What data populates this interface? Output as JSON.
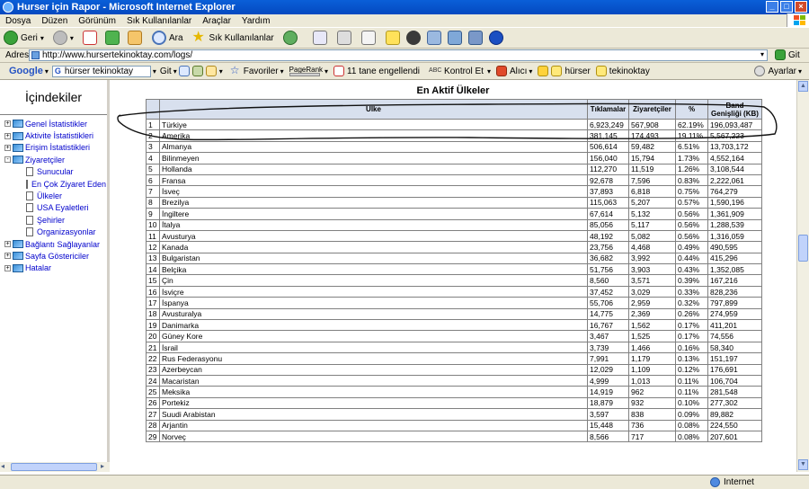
{
  "window": {
    "title": "Hurser için Rapor - Microsoft Internet Explorer"
  },
  "menu": [
    "Dosya",
    "Düzen",
    "Görünüm",
    "Sık Kullanılanlar",
    "Araçlar",
    "Yardım"
  ],
  "toolbar": {
    "back": "Geri",
    "search": "Ara",
    "favorites": "Sık Kullanılanlar"
  },
  "address": {
    "label": "Adres",
    "url": "http://www.hursertekinoktay.com/logs/",
    "go": "Git"
  },
  "google": {
    "logo": "Google",
    "query": "hürser tekinoktay",
    "go": "Git",
    "favorites": "Favoriler",
    "pagerank": "PageRank",
    "blocked": "11 tane engellendi",
    "spell": "Kontrol Et",
    "send": "Alıcı",
    "hl1": "hürser",
    "hl2": "tekinoktay",
    "settings": "Ayarlar"
  },
  "sidebar": {
    "title": "İçindekiler",
    "items": [
      {
        "label": "Genel İstatistikler",
        "level": 0,
        "type": "book",
        "exp": "+"
      },
      {
        "label": "Aktivite İstatistikleri",
        "level": 0,
        "type": "book",
        "exp": "+"
      },
      {
        "label": "Erişim İstatistikleri",
        "level": 0,
        "type": "book",
        "exp": "+"
      },
      {
        "label": "Ziyaretçiler",
        "level": 0,
        "type": "book",
        "exp": "-"
      },
      {
        "label": "Sunucular",
        "level": 1,
        "type": "doc"
      },
      {
        "label": "En Çok Ziyaret Eden Üs",
        "level": 1,
        "type": "doc"
      },
      {
        "label": "Ülkeler",
        "level": 1,
        "type": "doc"
      },
      {
        "label": "USA Eyaletleri",
        "level": 1,
        "type": "doc"
      },
      {
        "label": "Şehirler",
        "level": 1,
        "type": "doc"
      },
      {
        "label": "Organizasyonlar",
        "level": 1,
        "type": "doc"
      },
      {
        "label": "Bağlantı Sağlayanlar",
        "level": 0,
        "type": "book",
        "exp": "+"
      },
      {
        "label": "Sayfa Göstericiler",
        "level": 0,
        "type": "book",
        "exp": "+"
      },
      {
        "label": "Hatalar",
        "level": 0,
        "type": "book",
        "exp": "+"
      }
    ]
  },
  "report": {
    "title": "En Aktif Ülkeler",
    "columns": [
      "",
      "Ülke",
      "Tıklamalar",
      "Ziyaretçiler",
      "%",
      "Band Genişliği (KB)"
    ],
    "rows": [
      [
        "1",
        "Türkiye",
        "6,923,249",
        "567,908",
        "62.19%",
        "196,093,487"
      ],
      [
        "2",
        "Amerika",
        "381,145",
        "174,493",
        "19.11%",
        "5,567,223"
      ],
      [
        "3",
        "Almanya",
        "506,614",
        "59,482",
        "6.51%",
        "13,703,172"
      ],
      [
        "4",
        "Bilinmeyen",
        "156,040",
        "15,794",
        "1.73%",
        "4,552,164"
      ],
      [
        "5",
        "Hollanda",
        "112,270",
        "11,519",
        "1.26%",
        "3,108,544"
      ],
      [
        "6",
        "Fransa",
        "92,678",
        "7,596",
        "0.83%",
        "2,222,061"
      ],
      [
        "7",
        "İsveç",
        "37,893",
        "6,818",
        "0.75%",
        "764,279"
      ],
      [
        "8",
        "Brezilya",
        "115,063",
        "5,207",
        "0.57%",
        "1,590,196"
      ],
      [
        "9",
        "İngiltere",
        "67,614",
        "5,132",
        "0.56%",
        "1,361,909"
      ],
      [
        "10",
        "İtalya",
        "85,056",
        "5,117",
        "0.56%",
        "1,288,539"
      ],
      [
        "11",
        "Avusturya",
        "48,192",
        "5,082",
        "0.56%",
        "1,316,059"
      ],
      [
        "12",
        "Kanada",
        "23,756",
        "4,468",
        "0.49%",
        "490,595"
      ],
      [
        "13",
        "Bulgaristan",
        "36,682",
        "3,992",
        "0.44%",
        "415,296"
      ],
      [
        "14",
        "Belçika",
        "51,756",
        "3,903",
        "0.43%",
        "1,352,085"
      ],
      [
        "15",
        "Çin",
        "8,560",
        "3,571",
        "0.39%",
        "167,216"
      ],
      [
        "16",
        "İsviçre",
        "37,452",
        "3,029",
        "0.33%",
        "828,236"
      ],
      [
        "17",
        "İspanya",
        "55,706",
        "2,959",
        "0.32%",
        "797,899"
      ],
      [
        "18",
        "Avusturalya",
        "14,775",
        "2,369",
        "0.26%",
        "274,959"
      ],
      [
        "19",
        "Danimarka",
        "16,767",
        "1,562",
        "0.17%",
        "411,201"
      ],
      [
        "20",
        "Güney Kore",
        "3,467",
        "1,525",
        "0.17%",
        "74,556"
      ],
      [
        "21",
        "İsrail",
        "3,739",
        "1,466",
        "0.16%",
        "58,340"
      ],
      [
        "22",
        "Rus Federasyonu",
        "7,991",
        "1,179",
        "0.13%",
        "151,197"
      ],
      [
        "23",
        "Azerbeycan",
        "12,029",
        "1,109",
        "0.12%",
        "176,691"
      ],
      [
        "24",
        "Macaristan",
        "4,999",
        "1,013",
        "0.11%",
        "106,704"
      ],
      [
        "25",
        "Meksika",
        "14,919",
        "962",
        "0.11%",
        "281,548"
      ],
      [
        "26",
        "Portekiz",
        "18,879",
        "932",
        "0.10%",
        "277,302"
      ],
      [
        "27",
        "Suudi Arabistan",
        "3,597",
        "838",
        "0.09%",
        "89,882"
      ],
      [
        "28",
        "Arjantin",
        "15,448",
        "736",
        "0.08%",
        "224,550"
      ],
      [
        "29",
        "Norveç",
        "8,566",
        "717",
        "0.08%",
        "207,601"
      ]
    ]
  },
  "status": {
    "zone": "Internet"
  }
}
